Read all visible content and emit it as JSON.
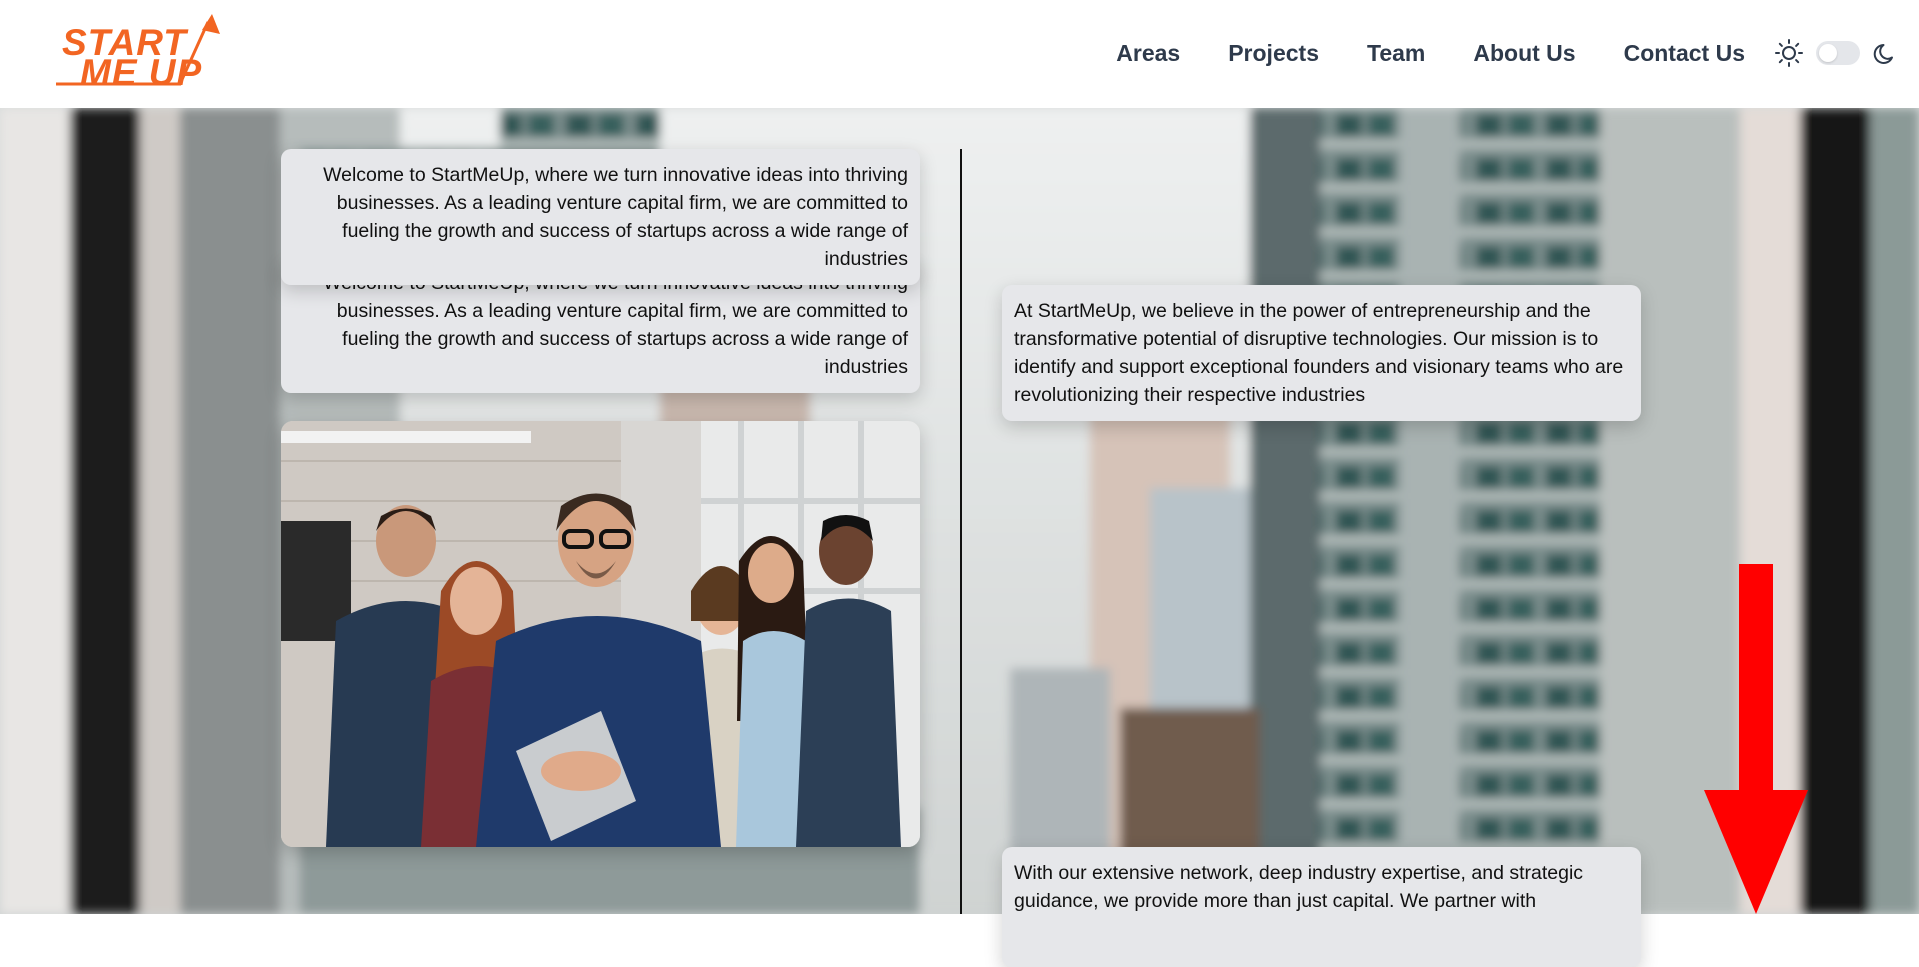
{
  "brand": {
    "logo_line1": "START",
    "logo_line2": "ME UP",
    "logo_color": "#f26522"
  },
  "nav": {
    "items": [
      {
        "label": "Areas"
      },
      {
        "label": "Projects"
      },
      {
        "label": "Team"
      },
      {
        "label": "About Us"
      },
      {
        "label": "Contact Us"
      }
    ]
  },
  "theme_toggle": {
    "light_icon": "sun-icon",
    "dark_icon": "moon-icon",
    "state": "light"
  },
  "content": {
    "intro": "Welcome to StartMeUp, where we turn innovative ideas into thriving businesses. As a leading venture capital firm, we are committed to fueling the growth and success of startups across a wide range of industries",
    "mission": "At StartMeUp, we believe in the power of entrepreneurship and the transformative potential of disruptive technologies. Our mission is to identify and support exceptional founders and visionary teams who are revolutionizing their respective industries",
    "network": "With our extensive network, deep industry expertise, and strategic guidance, we provide more than just capital. We partner with"
  },
  "colors": {
    "nav_text": "#2e3a4b",
    "card_bg": "#e6e7ea",
    "scroll_arrow": "#ff0000"
  },
  "icons": {
    "team_photo": "team-photo",
    "scroll_arrow": "scroll-down-arrow-icon"
  }
}
